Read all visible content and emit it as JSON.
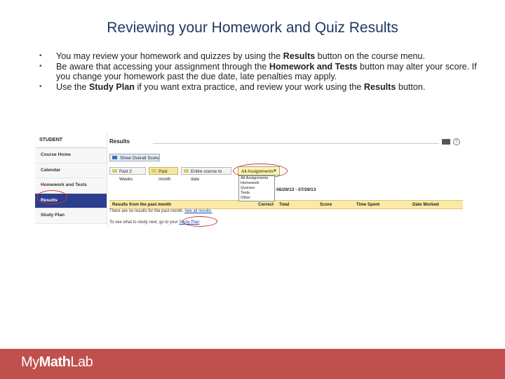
{
  "slide": {
    "title": "Reviewing your Homework and Quiz Results",
    "bullets": [
      [
        "You may review your homework and quizzes by using the ",
        "Results",
        " button on the course menu.",
        "",
        ""
      ],
      [
        "Be aware that accessing your assignment through the ",
        "Homework and Tests",
        " button may alter your score. If you change your homework past the due date, late penalties may apply.",
        "",
        ""
      ],
      [
        "Use the ",
        "Study Plan",
        " if you want extra practice, and review your work using the ",
        "Results",
        " button."
      ]
    ]
  },
  "screenshot": {
    "sidebar": {
      "header": "STUDENT",
      "items": [
        "Course Home",
        "Calendar",
        "Homework and Tests",
        "Results",
        "Study Plan"
      ],
      "active_index": 3
    },
    "main": {
      "title": "Results",
      "overall_button": "Show Overall Score",
      "filters": [
        "Past 2 Weeks",
        "Past month",
        "Entire course to date"
      ],
      "selected_filter": "Past month",
      "assignment_select": "All Assignments",
      "dropdown_options": [
        "All Assignments",
        "Homework",
        "Quizzes",
        "Tests",
        "Other"
      ],
      "date_range": "06/29/13 - 07/29/13",
      "table_headers": [
        "Results from the past month",
        "Correct",
        "Total",
        "Score",
        "Time Spent",
        "Date Worked"
      ],
      "no_results": "There are no results for the past month. ",
      "see_all_link": "See all results.",
      "study_next": "To see what to study next, go to your ",
      "study_plan_link": "Study Plan"
    },
    "icons": [
      "printer-icon",
      "help-icon"
    ],
    "highlight_color": "#c0392b",
    "active_nav_color": "#2c3e8f"
  },
  "footer": {
    "brand_my": "My",
    "brand_math": "Math",
    "brand_lab": "Lab",
    "color": "#c0504d"
  }
}
